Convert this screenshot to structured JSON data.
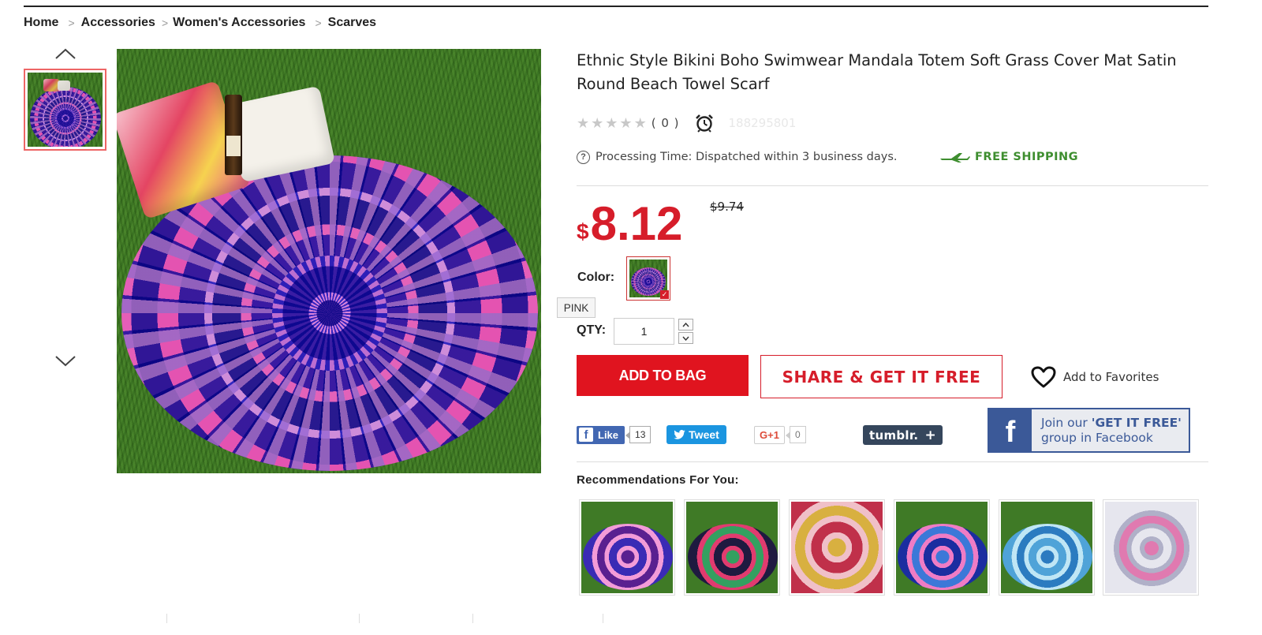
{
  "breadcrumb": {
    "items": [
      "Home",
      "Accessories",
      "Women's Accessories",
      "Scarves"
    ]
  },
  "product": {
    "title": "Ethnic Style Bikini Boho Swimwear Mandala Totem Soft Grass Cover Mat Satin Round Beach Towel Scarf",
    "rating_value": 0,
    "rating_max": 5,
    "review_count": "( 0 )",
    "sku": "188295801",
    "processing_time": "Processing Time: Dispatched within 3 business days.",
    "free_shipping": "FREE SHIPPING",
    "price_currency": "$",
    "price": "8.12",
    "old_price": "$9.74",
    "color_label": "Color:",
    "color_selected": "PINK",
    "qty_label": "QTY:",
    "qty_value": "1"
  },
  "actions": {
    "add_to_bag": "ADD TO BAG",
    "share": "SHARE & GET IT FREE",
    "favorites": "Add to Favorites"
  },
  "social": {
    "fb_like": "Like",
    "fb_like_count": "13",
    "tweet": "Tweet",
    "gplus": "G+1",
    "gplus_count": "0",
    "tumblr": "tumblr.",
    "fb_group_line1_prefix": "Join our ",
    "fb_group_line1_bold": "'GET IT FREE'",
    "fb_group_line2": "group in Facebook"
  },
  "recommendations": {
    "title": "Recommendations For You:",
    "items": [
      {
        "name": "rec-1",
        "colors": [
          "#3a2bb5",
          "#f39bd8",
          "#5a2090"
        ]
      },
      {
        "name": "rec-2",
        "colors": [
          "#1f1a40",
          "#e13b6f",
          "#33a060"
        ]
      },
      {
        "name": "rec-3",
        "colors": [
          "#c0304a",
          "#f0c0c8",
          "#d8b040"
        ]
      },
      {
        "name": "rec-4",
        "colors": [
          "#1b2da0",
          "#ef7cc5",
          "#3c78d8"
        ]
      },
      {
        "name": "rec-5",
        "colors": [
          "#4fa3d8",
          "#bfe6f5",
          "#2b7bc0"
        ]
      },
      {
        "name": "rec-6",
        "colors": [
          "#e6e6ee",
          "#b0b0c8",
          "#e07ab0"
        ]
      }
    ]
  },
  "colors": {
    "accent_red": "#e0141f",
    "price_red": "#d61d2a",
    "free_ship_green": "#3e8e2f",
    "facebook_blue": "#3b5998",
    "twitter_blue": "#1b95e0",
    "tumblr_navy": "#35465c"
  },
  "icons": {
    "nav_up": "chevron-up-icon",
    "nav_down": "chevron-down-icon",
    "alarm": "alarm-clock-icon",
    "help": "question-circle-icon",
    "plane": "plane-icon",
    "heart": "heart-outline-icon"
  }
}
